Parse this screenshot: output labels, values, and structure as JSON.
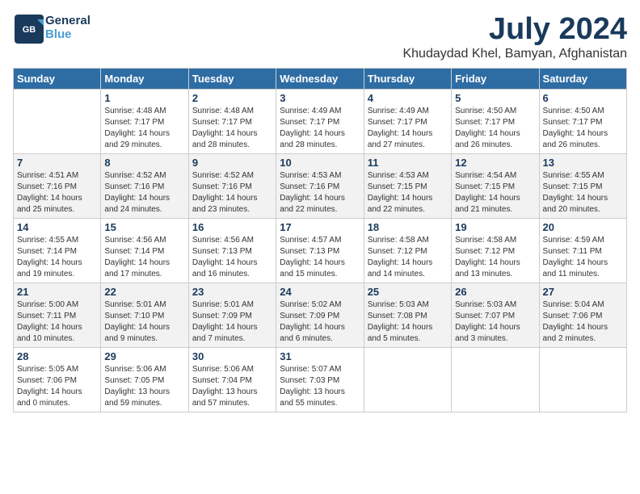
{
  "header": {
    "logo_text_general": "General",
    "logo_text_blue": "Blue",
    "month": "July 2024",
    "location": "Khudaydad Khel, Bamyan, Afghanistan"
  },
  "weekdays": [
    "Sunday",
    "Monday",
    "Tuesday",
    "Wednesday",
    "Thursday",
    "Friday",
    "Saturday"
  ],
  "weeks": [
    [
      {
        "day": "",
        "info": ""
      },
      {
        "day": "1",
        "info": "Sunrise: 4:48 AM\nSunset: 7:17 PM\nDaylight: 14 hours\nand 29 minutes."
      },
      {
        "day": "2",
        "info": "Sunrise: 4:48 AM\nSunset: 7:17 PM\nDaylight: 14 hours\nand 28 minutes."
      },
      {
        "day": "3",
        "info": "Sunrise: 4:49 AM\nSunset: 7:17 PM\nDaylight: 14 hours\nand 28 minutes."
      },
      {
        "day": "4",
        "info": "Sunrise: 4:49 AM\nSunset: 7:17 PM\nDaylight: 14 hours\nand 27 minutes."
      },
      {
        "day": "5",
        "info": "Sunrise: 4:50 AM\nSunset: 7:17 PM\nDaylight: 14 hours\nand 26 minutes."
      },
      {
        "day": "6",
        "info": "Sunrise: 4:50 AM\nSunset: 7:17 PM\nDaylight: 14 hours\nand 26 minutes."
      }
    ],
    [
      {
        "day": "7",
        "info": "Sunrise: 4:51 AM\nSunset: 7:16 PM\nDaylight: 14 hours\nand 25 minutes."
      },
      {
        "day": "8",
        "info": "Sunrise: 4:52 AM\nSunset: 7:16 PM\nDaylight: 14 hours\nand 24 minutes."
      },
      {
        "day": "9",
        "info": "Sunrise: 4:52 AM\nSunset: 7:16 PM\nDaylight: 14 hours\nand 23 minutes."
      },
      {
        "day": "10",
        "info": "Sunrise: 4:53 AM\nSunset: 7:16 PM\nDaylight: 14 hours\nand 22 minutes."
      },
      {
        "day": "11",
        "info": "Sunrise: 4:53 AM\nSunset: 7:15 PM\nDaylight: 14 hours\nand 22 minutes."
      },
      {
        "day": "12",
        "info": "Sunrise: 4:54 AM\nSunset: 7:15 PM\nDaylight: 14 hours\nand 21 minutes."
      },
      {
        "day": "13",
        "info": "Sunrise: 4:55 AM\nSunset: 7:15 PM\nDaylight: 14 hours\nand 20 minutes."
      }
    ],
    [
      {
        "day": "14",
        "info": "Sunrise: 4:55 AM\nSunset: 7:14 PM\nDaylight: 14 hours\nand 19 minutes."
      },
      {
        "day": "15",
        "info": "Sunrise: 4:56 AM\nSunset: 7:14 PM\nDaylight: 14 hours\nand 17 minutes."
      },
      {
        "day": "16",
        "info": "Sunrise: 4:56 AM\nSunset: 7:13 PM\nDaylight: 14 hours\nand 16 minutes."
      },
      {
        "day": "17",
        "info": "Sunrise: 4:57 AM\nSunset: 7:13 PM\nDaylight: 14 hours\nand 15 minutes."
      },
      {
        "day": "18",
        "info": "Sunrise: 4:58 AM\nSunset: 7:12 PM\nDaylight: 14 hours\nand 14 minutes."
      },
      {
        "day": "19",
        "info": "Sunrise: 4:58 AM\nSunset: 7:12 PM\nDaylight: 14 hours\nand 13 minutes."
      },
      {
        "day": "20",
        "info": "Sunrise: 4:59 AM\nSunset: 7:11 PM\nDaylight: 14 hours\nand 11 minutes."
      }
    ],
    [
      {
        "day": "21",
        "info": "Sunrise: 5:00 AM\nSunset: 7:11 PM\nDaylight: 14 hours\nand 10 minutes."
      },
      {
        "day": "22",
        "info": "Sunrise: 5:01 AM\nSunset: 7:10 PM\nDaylight: 14 hours\nand 9 minutes."
      },
      {
        "day": "23",
        "info": "Sunrise: 5:01 AM\nSunset: 7:09 PM\nDaylight: 14 hours\nand 7 minutes."
      },
      {
        "day": "24",
        "info": "Sunrise: 5:02 AM\nSunset: 7:09 PM\nDaylight: 14 hours\nand 6 minutes."
      },
      {
        "day": "25",
        "info": "Sunrise: 5:03 AM\nSunset: 7:08 PM\nDaylight: 14 hours\nand 5 minutes."
      },
      {
        "day": "26",
        "info": "Sunrise: 5:03 AM\nSunset: 7:07 PM\nDaylight: 14 hours\nand 3 minutes."
      },
      {
        "day": "27",
        "info": "Sunrise: 5:04 AM\nSunset: 7:06 PM\nDaylight: 14 hours\nand 2 minutes."
      }
    ],
    [
      {
        "day": "28",
        "info": "Sunrise: 5:05 AM\nSunset: 7:06 PM\nDaylight: 14 hours\nand 0 minutes."
      },
      {
        "day": "29",
        "info": "Sunrise: 5:06 AM\nSunset: 7:05 PM\nDaylight: 13 hours\nand 59 minutes."
      },
      {
        "day": "30",
        "info": "Sunrise: 5:06 AM\nSunset: 7:04 PM\nDaylight: 13 hours\nand 57 minutes."
      },
      {
        "day": "31",
        "info": "Sunrise: 5:07 AM\nSunset: 7:03 PM\nDaylight: 13 hours\nand 55 minutes."
      },
      {
        "day": "",
        "info": ""
      },
      {
        "day": "",
        "info": ""
      },
      {
        "day": "",
        "info": ""
      }
    ]
  ]
}
